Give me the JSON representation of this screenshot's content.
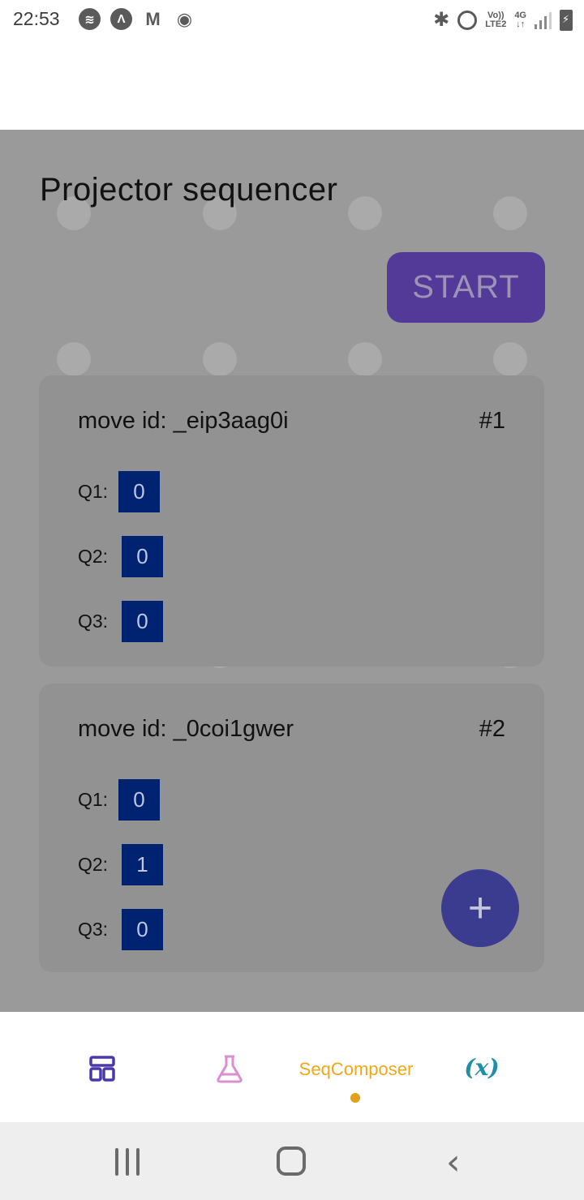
{
  "status_bar": {
    "time": "22:53",
    "left_icons": [
      "spotify-icon",
      "notification-a-icon",
      "gmail-icon",
      "hotspot-icon"
    ],
    "right_icons": [
      "bluetooth-icon",
      "alarm-icon",
      "volte-icon",
      "4g-icon",
      "signal-icon",
      "battery-charging-icon"
    ],
    "volte_top": "Vo))",
    "volte_bottom": "LTE2",
    "network_top": "4G",
    "network_bottom": "↓↑"
  },
  "page": {
    "title": "Projector sequencer",
    "start_label": "START"
  },
  "moves": [
    {
      "id_text": "move id: _eip3aag0i",
      "index": "#1",
      "q": [
        {
          "label": "Q1:",
          "value": "0"
        },
        {
          "label": "Q2:",
          "value": "0"
        },
        {
          "label": "Q3:",
          "value": "0"
        }
      ]
    },
    {
      "id_text": "move id: _0coi1gwer",
      "index": "#2",
      "q": [
        {
          "label": "Q1:",
          "value": "0"
        },
        {
          "label": "Q2:",
          "value": "1"
        },
        {
          "label": "Q3:",
          "value": "0"
        }
      ]
    }
  ],
  "fab": {
    "label": "+"
  },
  "bottom_nav": {
    "items": [
      {
        "name": "dashboard-icon"
      },
      {
        "name": "flask-icon"
      },
      {
        "name": "seqcomposer",
        "label": "SeqComposer",
        "active": true
      },
      {
        "name": "variable-icon",
        "label": "(x)"
      }
    ],
    "accent": "#e1a11a"
  },
  "colors": {
    "start_button": "#533a99",
    "value_box": "#002371",
    "fab": "#3b3b8f"
  }
}
